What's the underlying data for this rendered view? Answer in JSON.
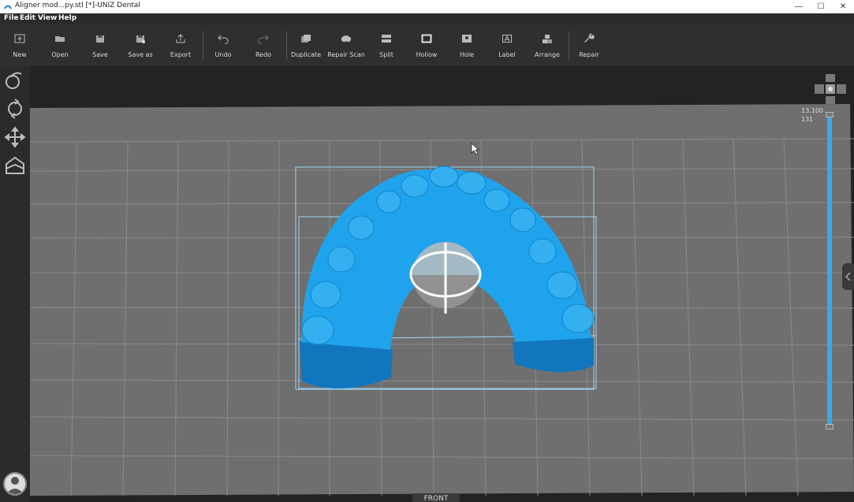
{
  "window": {
    "title": "Aligner mod...py.stl [*]-UNIZ Dental",
    "minimize_icon": "—",
    "maximize_icon": "☐",
    "close_icon": "✕"
  },
  "menu": [
    "File",
    "Edit",
    "View",
    "Help"
  ],
  "toolbar": [
    {
      "label": "New",
      "icon": "new-icon"
    },
    {
      "label": "Open",
      "icon": "open-icon"
    },
    {
      "label": "Save",
      "icon": "save-icon"
    },
    {
      "label": "Save as",
      "icon": "save-as-icon"
    },
    {
      "label": "Export",
      "icon": "export-icon"
    },
    {
      "label": "Undo",
      "icon": "undo-icon"
    },
    {
      "label": "Redo",
      "icon": "redo-icon"
    },
    {
      "label": "Duplicate",
      "icon": "duplicate-icon"
    },
    {
      "label": "Repair Scan",
      "icon": "repair-scan-icon"
    },
    {
      "label": "Split",
      "icon": "split-icon"
    },
    {
      "label": "Hollow",
      "icon": "hollow-icon"
    },
    {
      "label": "Hole",
      "icon": "hole-icon"
    },
    {
      "label": "Label",
      "icon": "label-icon"
    },
    {
      "label": "Arrange",
      "icon": "arrange-icon"
    },
    {
      "label": "Repair",
      "icon": "repair-icon"
    }
  ],
  "left_tools": [
    "view-icon",
    "rotate-icon",
    "move-icon",
    "platform-icon"
  ],
  "slider": {
    "top_value": "13.100",
    "layer_value": "131"
  },
  "view_label": "FRONT",
  "colors": {
    "model": "#1fa3ec",
    "accent": "#3aa8e8",
    "grid": "#8a8a8a"
  }
}
